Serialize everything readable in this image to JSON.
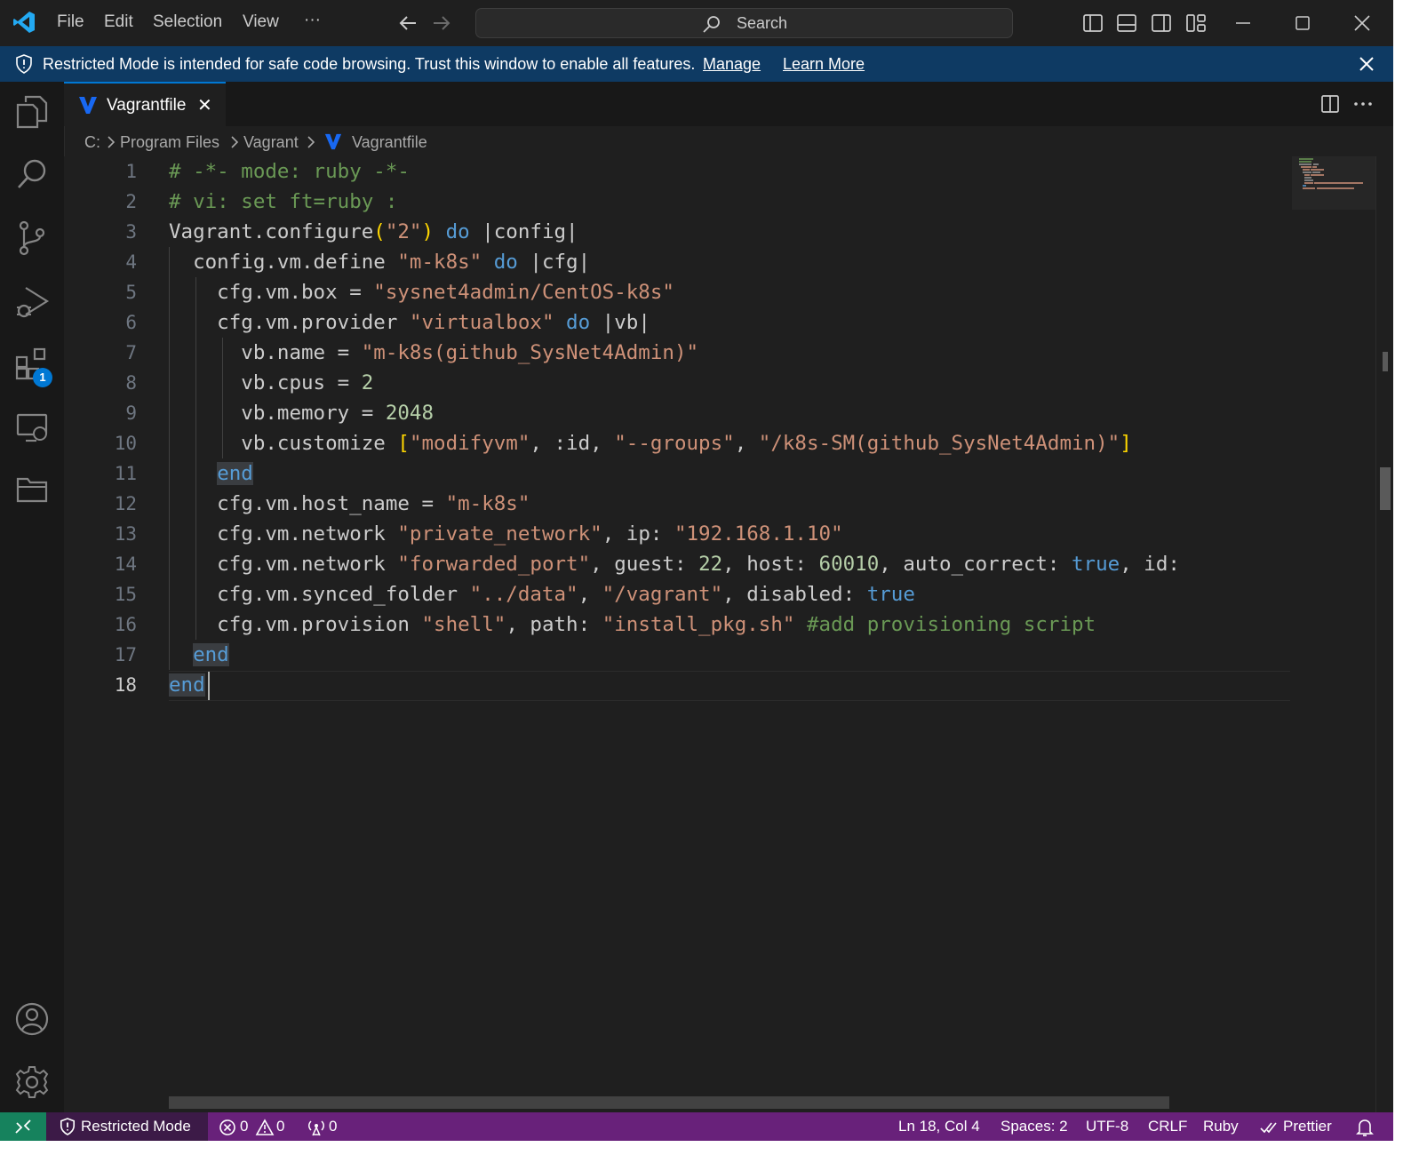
{
  "titlebar": {
    "menu": [
      "File",
      "Edit",
      "Selection",
      "View"
    ],
    "more": "···",
    "search_placeholder": "Search"
  },
  "banner": {
    "message": "Restricted Mode is intended for safe code browsing. Trust this window to enable all features.",
    "manage": "Manage",
    "learn_more": "Learn More"
  },
  "activity": {
    "extensions_badge": "1"
  },
  "tab": {
    "label": "Vagrantfile",
    "close": "✕"
  },
  "breadcrumb": [
    "C:",
    "Program Files",
    "Vagrant",
    "Vagrantfile"
  ],
  "editor": {
    "language_colors": {
      "comment": "#6a9955",
      "string": "#ce9178",
      "keyword": "#569cd6",
      "number": "#b5cea8",
      "bracket": "#ffd700"
    },
    "line_numbers": [
      "1",
      "2",
      "3",
      "4",
      "5",
      "6",
      "7",
      "8",
      "9",
      "10",
      "11",
      "12",
      "13",
      "14",
      "15",
      "16",
      "17",
      "18"
    ],
    "lines": [
      [
        {
          "t": "# -*- mode: ruby -*-",
          "c": "com"
        }
      ],
      [
        {
          "t": "# vi: set ft=ruby :",
          "c": "com"
        }
      ],
      [
        {
          "t": "Vagrant.configure"
        },
        {
          "t": "(",
          "c": "brk"
        },
        {
          "t": "\"2\"",
          "c": "str"
        },
        {
          "t": ")",
          "c": "brk"
        },
        {
          "t": " "
        },
        {
          "t": "do",
          "c": "kw"
        },
        {
          "t": " |config|"
        }
      ],
      [
        {
          "t": "  config.vm.define "
        },
        {
          "t": "\"m-k8s\"",
          "c": "str"
        },
        {
          "t": " "
        },
        {
          "t": "do",
          "c": "kw"
        },
        {
          "t": " |cfg|"
        }
      ],
      [
        {
          "t": "    cfg.vm.box = "
        },
        {
          "t": "\"sysnet4admin/CentOS-k8s\"",
          "c": "str"
        }
      ],
      [
        {
          "t": "    cfg.vm.provider "
        },
        {
          "t": "\"virtualbox\"",
          "c": "str"
        },
        {
          "t": " "
        },
        {
          "t": "do",
          "c": "kw"
        },
        {
          "t": " |vb|"
        }
      ],
      [
        {
          "t": "      vb.name = "
        },
        {
          "t": "\"m-k8s(github_SysNet4Admin)\"",
          "c": "str"
        }
      ],
      [
        {
          "t": "      vb.cpus = "
        },
        {
          "t": "2",
          "c": "num"
        }
      ],
      [
        {
          "t": "      vb.memory = "
        },
        {
          "t": "2048",
          "c": "num"
        }
      ],
      [
        {
          "t": "      vb.customize "
        },
        {
          "t": "[",
          "c": "brk"
        },
        {
          "t": "\"modifyvm\"",
          "c": "str"
        },
        {
          "t": ", :id, "
        },
        {
          "t": "\"--groups\"",
          "c": "str"
        },
        {
          "t": ", "
        },
        {
          "t": "\"/k8s-SM(github_SysNet4Admin)\"",
          "c": "str"
        },
        {
          "t": "]",
          "c": "brk"
        }
      ],
      [
        {
          "t": "    "
        },
        {
          "t": "end",
          "c": "kw",
          "hl": true
        }
      ],
      [
        {
          "t": "    cfg.vm.host_name = "
        },
        {
          "t": "\"m-k8s\"",
          "c": "str"
        }
      ],
      [
        {
          "t": "    cfg.vm.network "
        },
        {
          "t": "\"private_network\"",
          "c": "str"
        },
        {
          "t": ", ip: "
        },
        {
          "t": "\"192.168.1.10\"",
          "c": "str"
        }
      ],
      [
        {
          "t": "    cfg.vm.network "
        },
        {
          "t": "\"forwarded_port\"",
          "c": "str"
        },
        {
          "t": ", guest: "
        },
        {
          "t": "22",
          "c": "num"
        },
        {
          "t": ", host: "
        },
        {
          "t": "60010",
          "c": "num"
        },
        {
          "t": ", auto_correct: "
        },
        {
          "t": "true",
          "c": "kw"
        },
        {
          "t": ", id:"
        }
      ],
      [
        {
          "t": "    cfg.vm.synced_folder "
        },
        {
          "t": "\"../data\"",
          "c": "str"
        },
        {
          "t": ", "
        },
        {
          "t": "\"/vagrant\"",
          "c": "str"
        },
        {
          "t": ", disabled: "
        },
        {
          "t": "true",
          "c": "kw"
        }
      ],
      [
        {
          "t": "    cfg.vm.provision "
        },
        {
          "t": "\"shell\"",
          "c": "str"
        },
        {
          "t": ", path: "
        },
        {
          "t": "\"install_pkg.sh\"",
          "c": "str"
        },
        {
          "t": " "
        },
        {
          "t": "#add provisioning script",
          "c": "com"
        }
      ],
      [
        {
          "t": "  "
        },
        {
          "t": "end",
          "c": "kw",
          "hl": true
        }
      ],
      [
        {
          "t": "end",
          "c": "kw",
          "hl": true
        }
      ]
    ]
  },
  "statusbar": {
    "restricted": "Restricted Mode",
    "errors": "0",
    "warnings": "0",
    "ports": "0",
    "position": "Ln 18, Col 4",
    "spaces": "Spaces: 2",
    "encoding": "UTF-8",
    "eol": "CRLF",
    "language": "Ruby",
    "formatter": "Prettier"
  }
}
